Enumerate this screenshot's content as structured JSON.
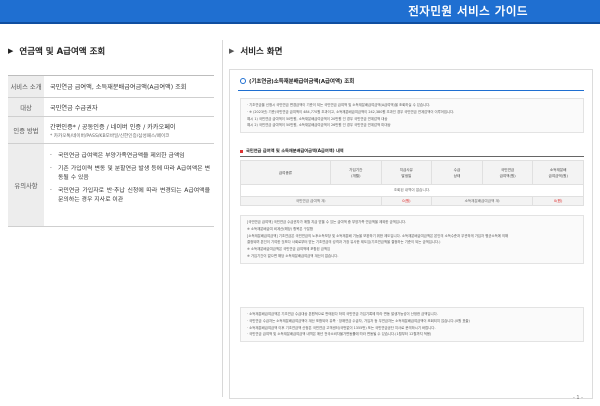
{
  "header": {
    "title": "전자민원 서비스 가이드"
  },
  "left": {
    "title": "연금액 및 A급여액 조회",
    "rows": [
      {
        "label": "서비스 소개",
        "value": "국민연금 급여액, 소득재분배급여금액(A급여액) 조회"
      },
      {
        "label": "대상",
        "value": "국민연금 수급권자"
      },
      {
        "label": "인증 방법",
        "value": "간편인증* / 공동인증 / 네이버 인증 / 카카오페이",
        "note": "* 카카오톡/네이버/PASS/KB모바일/신한인증/삼성패스/페이코"
      },
      {
        "label": "유의사항",
        "bullets": [
          "국민연금 급여액은 부양가족연금액을 제외한 금액임",
          "기존 가입이력 변동 및 분할연금 발생 등에 따라 A급여액은 변동될 수 있음",
          "국민연금 가입자로 반·추납 신청에 따라 변경되는 A급여액을 문의하는 경우 지사로 이관"
        ]
      }
    ]
  },
  "right": {
    "title": "서비스 화면",
    "panel": {
      "heading": "(기초연금)소득재분배급여금액(A급여액) 조회",
      "notice1": [
        "· 기초연금을 신청시 국민연금 변경금액이 기준이 되는 국민연금 급여액 및 소득재분배급여금액(A급여액)을 조회하실 수 있습니다.",
        "· ※ (2023년) 기준)국민연금 급여액이 484,770원 초과이고, 소득재분배급여금액이 242,380원 초과인 경우 국민연금 연계감액이 이루어집니다.",
        "  예시 1) 국민연금 급여액이 50만원, 소득재분배급여금액이 20만원 인 경우 국민연금 연계감액 대상",
        "  예시 2) 국민연금 급여액이 50만원, 소득재분배급여금액이 26만원 인 경우 국민연금 연계감액 미대상"
      ],
      "subheading": "국민연금 급여액 및 소득재분배급여금액(A급여액) 내역",
      "table": {
        "headers": [
          "급여종류",
          "가입기간\n(개월)",
          "지급사유\n발생일",
          "수급\n상태",
          "국민연금\n급여액(원)",
          "소득재분배\n급여금액(원)"
        ],
        "empty_text": "조회된 내역이 없습니다.",
        "sum_label_1": "국민연금 급여액 계:",
        "sum_value_1": "0(원)",
        "sum_label_2": "소득재분배급여금액 계:",
        "sum_value_2": "0(원)"
      },
      "notice2": [
        "[국민연금 급여액] 국민연금 수급권자가 매월 지급 받을 수 있는 급여액 중 부양가족 연금액을 제외한 금액입니다.",
        "※ 소득재분배급여 비계산(해당) 항목은 구분함",
        "",
        "[소득재분배급여금액] 기초연금은 국민연금의 노후소득보장 및 소득재분배 기능을 보완하기 위한 제도입니다. 소득재분배급여금액은 본인의 소득수준과 무관하게 가입자 평균소득에 의해",
        "결정되며 본인이 기여한 것보다 사회로부터 받는 기초연금의 성격과 가장 유사한 제도임(기초연금액을 결정하는 기준이 되는 금액입니다.)",
        "※ 소득재분배급여금액은 국민연금 급여액에 포함된 금액임",
        "※ 가입기간이 없으면 해당 소득재분배급여금액 계산이 없습니다."
      ],
      "notice3": [
        "· 소득재분배급여금액은 기초연금 수급대상 본원적으로 판매된다 하여 국민연금 가입기록에 따라 변동 발생가능성이 산정한 금액입니다.",
        "· 국민연금 수급자는 소득재분배급여금액이 계산 포함되어 유족 · 장애연금 수급자, 가입자 등 무연금자는 소득재분배급여금액이 조회되지 않습니다.(0원 표출)",
        "· 소득재분배급여금액 이후 기초연금액 산정은 국민연금 고객센터(국번없이 1355번) 또는 국민연금공단 지사로 문의하시기 바랍니다.",
        "· 국민연금 급여액 및 소득재분배급여금액 내역은 매년 전국소비자물가변동률에 따라 변동될 수 있습니다.(1월부터 12월까지 적용)"
      ]
    }
  },
  "page_number": "- 1 -"
}
